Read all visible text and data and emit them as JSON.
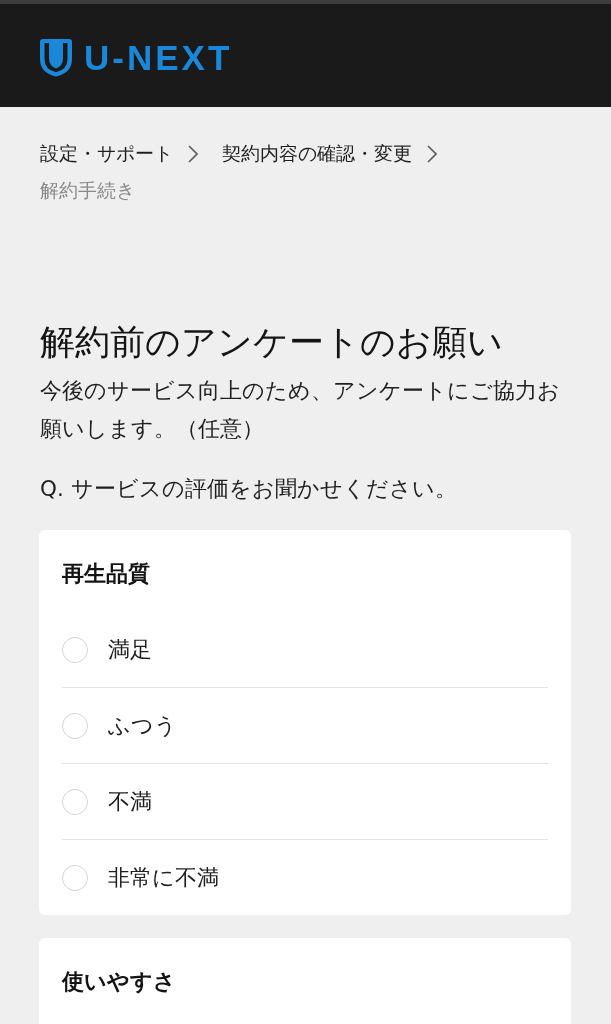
{
  "header": {
    "logo_text": "U-NEXT"
  },
  "breadcrumb": [
    {
      "label": "設定・サポート",
      "current": false
    },
    {
      "label": "契約内容の確認・変更",
      "current": false
    },
    {
      "label": "解約手続き",
      "current": true
    }
  ],
  "page_title": "解約前のアンケートのお願い",
  "intro": "今後のサービス向上のため、アンケートにご協力お願いします。（任意）",
  "question": "Q. サービスの評価をお聞かせください。",
  "categories": [
    {
      "title": "再生品質",
      "options": [
        {
          "label": "満足",
          "selected": false
        },
        {
          "label": "ふつう",
          "selected": false
        },
        {
          "label": "不満",
          "selected": false
        },
        {
          "label": "非常に不満",
          "selected": false
        }
      ]
    },
    {
      "title": "使いやすさ"
    }
  ]
}
